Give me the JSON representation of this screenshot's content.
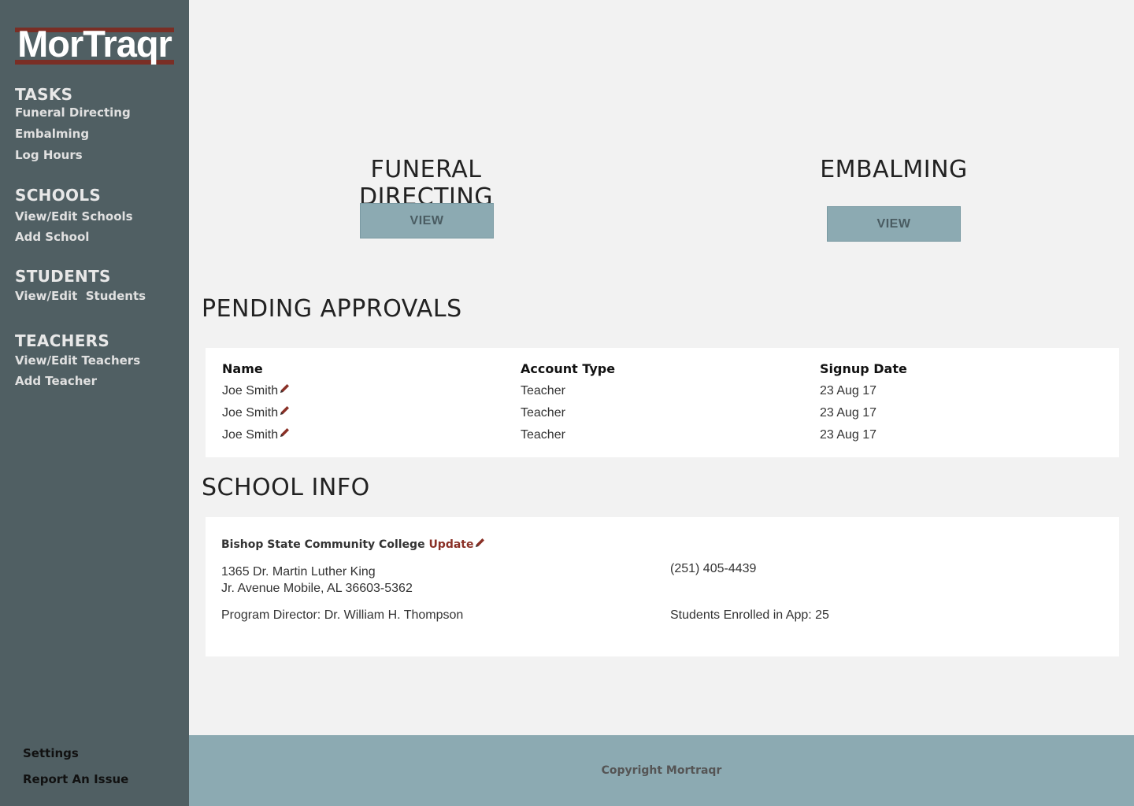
{
  "app": {
    "logo_text": "MorTraqr",
    "brand_color": "#7a2e25",
    "sidebar_color": "#505f63",
    "accent_color": "#8caab2"
  },
  "sidebar": {
    "sections": [
      {
        "heading": "TASKS",
        "links": [
          "Funeral Directing",
          "Embalming",
          "Log Hours"
        ]
      },
      {
        "heading": "SCHOOLS",
        "links": [
          "View/Edit Schools",
          "Add School"
        ]
      },
      {
        "heading": "STUDENTS",
        "links": [
          "View/Edit  Students"
        ]
      },
      {
        "heading": "TEACHERS",
        "links": [
          "View/Edit Teachers",
          "Add Teacher"
        ]
      }
    ],
    "bottom_links": [
      "Settings",
      "Report An Issue"
    ]
  },
  "tasks": {
    "funeral": {
      "title": "FUNERAL DIRECTING",
      "button": "VIEW"
    },
    "embalming": {
      "title": "EMBALMING",
      "button": "VIEW"
    }
  },
  "approvals": {
    "title": "PENDING APPROVALS",
    "columns": [
      "Name",
      "Account Type",
      "Signup Date"
    ],
    "rows": [
      {
        "name": "Joe Smith",
        "type": "Teacher",
        "date": "23 Aug 17"
      },
      {
        "name": "Joe Smith",
        "type": "Teacher",
        "date": "23 Aug 17"
      },
      {
        "name": "Joe Smith",
        "type": "Teacher",
        "date": "23 Aug 17"
      }
    ],
    "edit_icon": "pencil-icon"
  },
  "school": {
    "title": "SCHOOL INFO",
    "name": "Bishop State Community College",
    "update_label": "Update",
    "address_line1": "1365 Dr. Martin Luther King",
    "address_line2": "Jr. Avenue Mobile, AL 36603-5362",
    "phone": "(251) 405-4439",
    "director": "Program Director: Dr. William H. Thompson",
    "enrolled": "Students Enrolled in App: 25"
  },
  "footer": {
    "copyright": "Copyright Mortraqr"
  }
}
